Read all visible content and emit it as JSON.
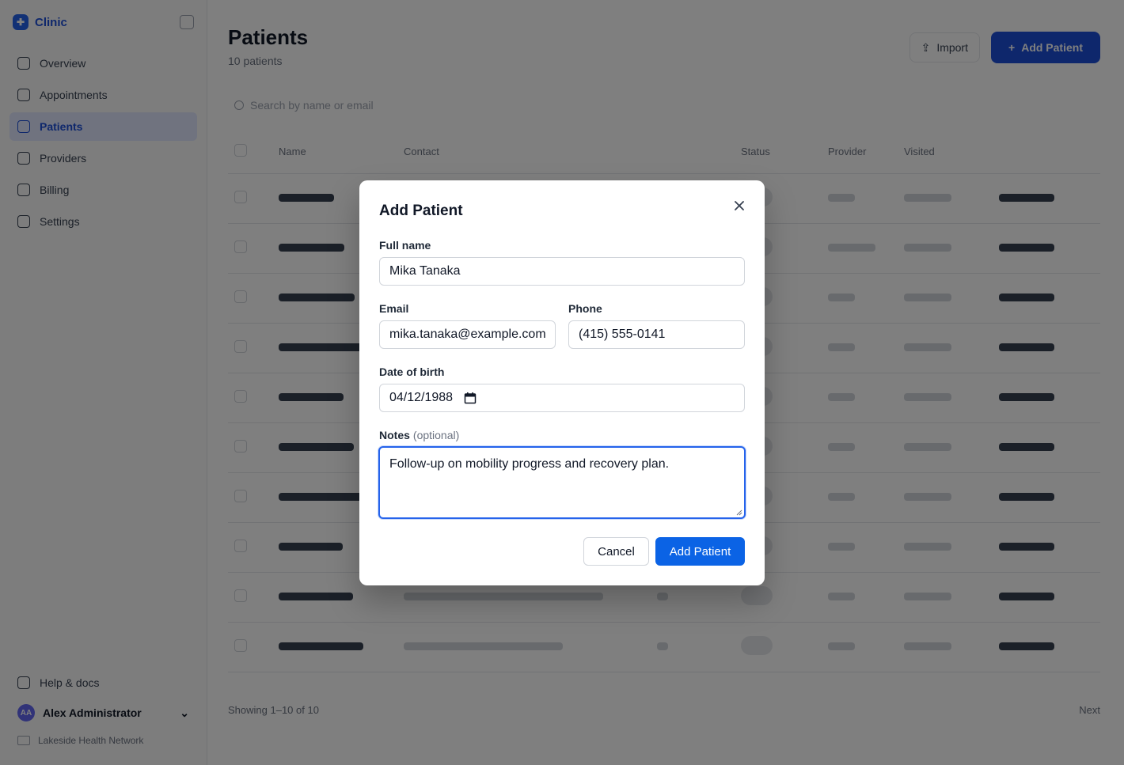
{
  "background": {
    "logo_text": "Clinic",
    "nav": [
      {
        "label": "Overview"
      },
      {
        "label": "Appointments"
      },
      {
        "label": "Patients"
      },
      {
        "label": "Providers"
      },
      {
        "label": "Billing"
      },
      {
        "label": "Settings"
      }
    ],
    "help_label": "Help & docs",
    "user_name": "Alex Administrator",
    "org_label": "Lakeside Health Network",
    "page_title": "Patients",
    "page_subtitle": "10 patients",
    "import_label": "Import",
    "new_patient_label": "Add Patient",
    "search_placeholder": "Search by name or email",
    "table_headers": [
      "Name",
      "Contact",
      "",
      "Status",
      "Provider",
      "Visited"
    ],
    "pagination_left": "Showing 1–10 of 10",
    "pagination_right": "Next"
  },
  "modal": {
    "title": "Add Patient",
    "full_name": {
      "label": "Full name",
      "value": "Mika Tanaka"
    },
    "email": {
      "label": "Email",
      "value": "mika.tanaka@example.com"
    },
    "phone": {
      "label": "Phone",
      "value": "(415) 555-0141"
    },
    "dob": {
      "label": "Date of birth",
      "value": "04/12/1988"
    },
    "notes": {
      "label": "Notes",
      "optional": "(optional)",
      "value": "Follow-up on mobility progress and recovery plan."
    },
    "cancel_label": "Cancel",
    "submit_label": "Add Patient"
  },
  "colors": {
    "primary": "#0b63e5",
    "focus_ring": "#2563eb",
    "overlay": "rgba(0,0,0,0.5)"
  }
}
